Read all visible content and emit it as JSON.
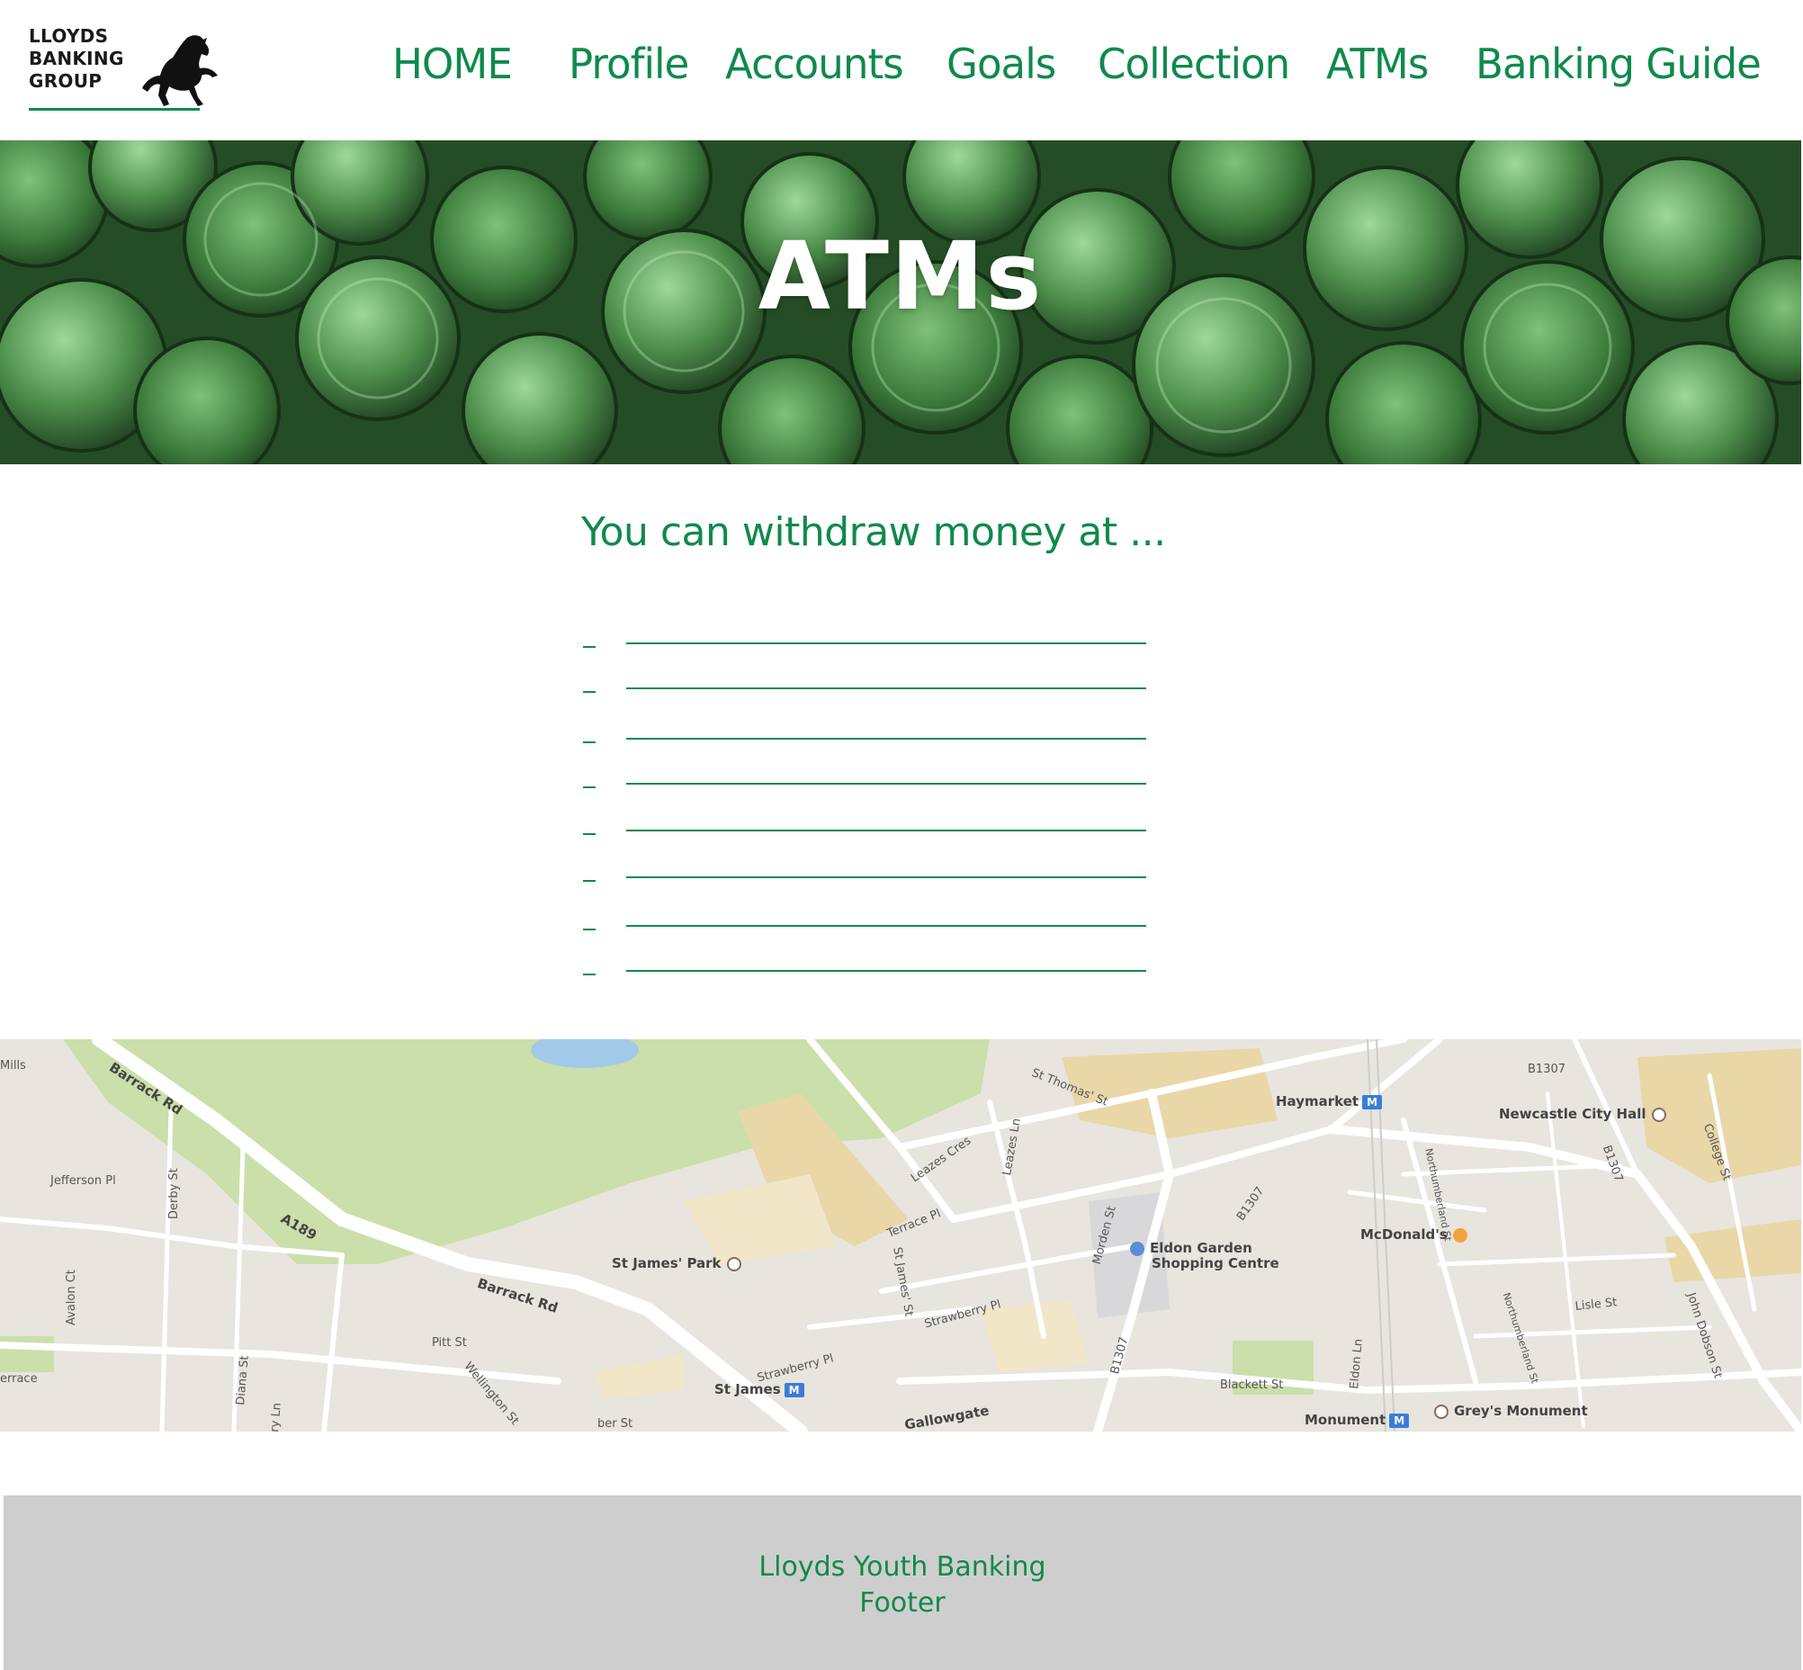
{
  "brand": {
    "logo_lines": [
      "LLOYDS",
      "BANKING",
      "GROUP"
    ],
    "primary_color": "#0f8a4c"
  },
  "nav": {
    "items": [
      {
        "label": "HOME"
      },
      {
        "label": "Profile"
      },
      {
        "label": "Accounts"
      },
      {
        "label": "Goals"
      },
      {
        "label": "Collection"
      },
      {
        "label": "ATMs"
      },
      {
        "label": "Banking Guide"
      }
    ]
  },
  "hero": {
    "title": "ATMs",
    "background": "green-tinted coins photo"
  },
  "withdraw": {
    "title": "You can withdraw money at ...",
    "blank_count": 8
  },
  "map": {
    "labels": {
      "barrack_rd": "Barrack Rd",
      "barrack_rd_2": "Barrack Rd",
      "a189": "A189",
      "jefferson_pl": "Jefferson Pl",
      "derby_st": "Derby St",
      "avalon_ct": "Avalon Ct",
      "diana_st": "Diana St",
      "pitt_st": "Pitt St",
      "wellington_st": "Wellington St",
      "st_james_park": "St James' Park",
      "st_james": "St James",
      "strawberry_pl": "Strawberry Pl",
      "strawberry_pl_2": "Strawberry Pl",
      "terrace_pl": "Terrace Pl",
      "st_james_st": "St James' St",
      "leazes_cres": "Leazes Cres",
      "leazes_ln": "Leazes Ln",
      "st_thomas_st": "St Thomas' St",
      "haymarket": "Haymarket",
      "newcastle_city_hall": "Newcastle City Hall",
      "b1307_top": "B1307",
      "b1307_mid": "B1307",
      "b1307_right": "B1307",
      "b1307_low": "B1307",
      "college_st": "College St",
      "northumberland_st": "Northumberland St",
      "northumberland_st_2": "Northumberland St",
      "mcdonalds": "McDonald's",
      "eldon_garden": "Eldon Garden",
      "shopping_centre": "Shopping Centre",
      "morden_st": "Morden St",
      "lisle_st": "Lisle St",
      "john_dobson_st": "John Dobson St",
      "gallowgate": "Gallowgate",
      "blackett_st": "Blackett St",
      "eldon_ln": "Eldon Ln",
      "monument": "Monument",
      "greys_monument": "Grey's Monument",
      "mills": "Mills",
      "errace": "errace",
      "ry_ln": "ry Ln",
      "ber_st": "ber St",
      "metro_symbol": "M"
    }
  },
  "footer": {
    "line1": "Lloyds Youth Banking",
    "line2": "Footer"
  }
}
